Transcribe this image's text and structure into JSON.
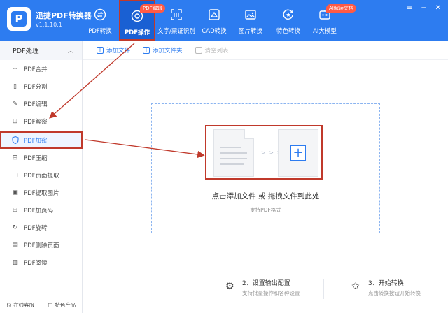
{
  "app": {
    "name": "迅捷PDF转换器",
    "version": "v1.1.10.1",
    "logo_letter": "P"
  },
  "nav": [
    {
      "label": "PDF转换",
      "icon": "convert-icon"
    },
    {
      "label": "PDF操作",
      "icon": "target-icon",
      "badge": "PDF编辑",
      "active": true
    },
    {
      "label": "文字/票证识别",
      "icon": "scan-icon"
    },
    {
      "label": "CAD转换",
      "icon": "cad-icon"
    },
    {
      "label": "图片转换",
      "icon": "image-icon"
    },
    {
      "label": "特色转换",
      "icon": "star-refresh-icon"
    },
    {
      "label": "AI大模型",
      "icon": "ai-icon",
      "badge": "AI解读文档"
    }
  ],
  "sidebar": {
    "title": "PDF处理",
    "items": [
      {
        "label": "PDF合并",
        "icon": "merge-icon"
      },
      {
        "label": "PDF分割",
        "icon": "split-icon"
      },
      {
        "label": "PDF编辑",
        "icon": "edit-icon"
      },
      {
        "label": "PDF解密",
        "icon": "unlock-icon"
      },
      {
        "label": "PDF加密",
        "icon": "shield-icon",
        "active": true
      },
      {
        "label": "PDF压缩",
        "icon": "compress-icon"
      },
      {
        "label": "PDF页面提取",
        "icon": "page-extract-icon"
      },
      {
        "label": "PDF提取图片",
        "icon": "image-extract-icon"
      },
      {
        "label": "PDF加页码",
        "icon": "page-number-icon"
      },
      {
        "label": "PDF旋转",
        "icon": "rotate-icon"
      },
      {
        "label": "PDF删除页面",
        "icon": "delete-page-icon"
      },
      {
        "label": "PDF阅读",
        "icon": "read-icon"
      }
    ],
    "footer": {
      "service": "在线客服",
      "products": "特色产品"
    }
  },
  "toolbar": {
    "add_file": "添加文件",
    "add_folder": "添加文件夹",
    "clear_list": "清空列表"
  },
  "dropzone": {
    "title": "点击添加文件 或 拖拽文件到此处",
    "subtitle": "支持PDF格式",
    "arrows": "> > >"
  },
  "steps": [
    {
      "title": "2、设置输出配置",
      "desc": "支持批量操作和各种设置"
    },
    {
      "title": "3、开始转换",
      "desc": "点击转换按钮开始转换"
    }
  ],
  "colors": {
    "brand": "#2d7cf0",
    "annotation": "#c0392b",
    "badge": "#ff5a45"
  }
}
